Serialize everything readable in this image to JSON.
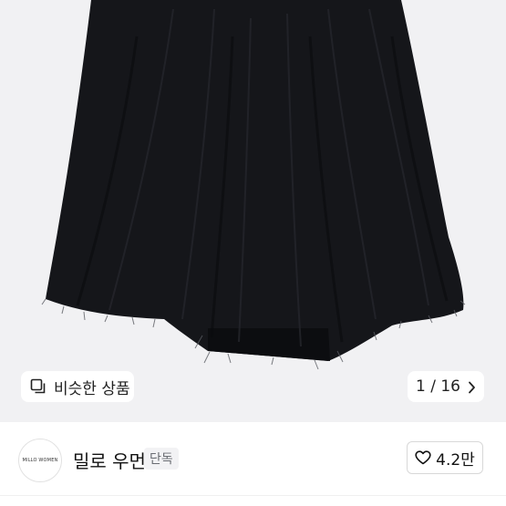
{
  "product_image": {
    "subject": "black-flared-skirt-photo"
  },
  "image_controls": {
    "similar_products_label": "비슷한 상품",
    "similar_icon": "similar-items-icon",
    "counter_text": "1 / 16",
    "next_icon": "chevron-right-icon"
  },
  "shop": {
    "logo_text": "MILLO WOMEN",
    "name": "밀로 우먼",
    "badge": "단독",
    "like_icon": "heart-outline-icon",
    "like_count": "4.2만"
  },
  "colors": {
    "image_background": "#f1f1f3",
    "skirt": "#15161a",
    "badge_background": "#f2f2f4",
    "badge_text": "#6a6d73"
  }
}
